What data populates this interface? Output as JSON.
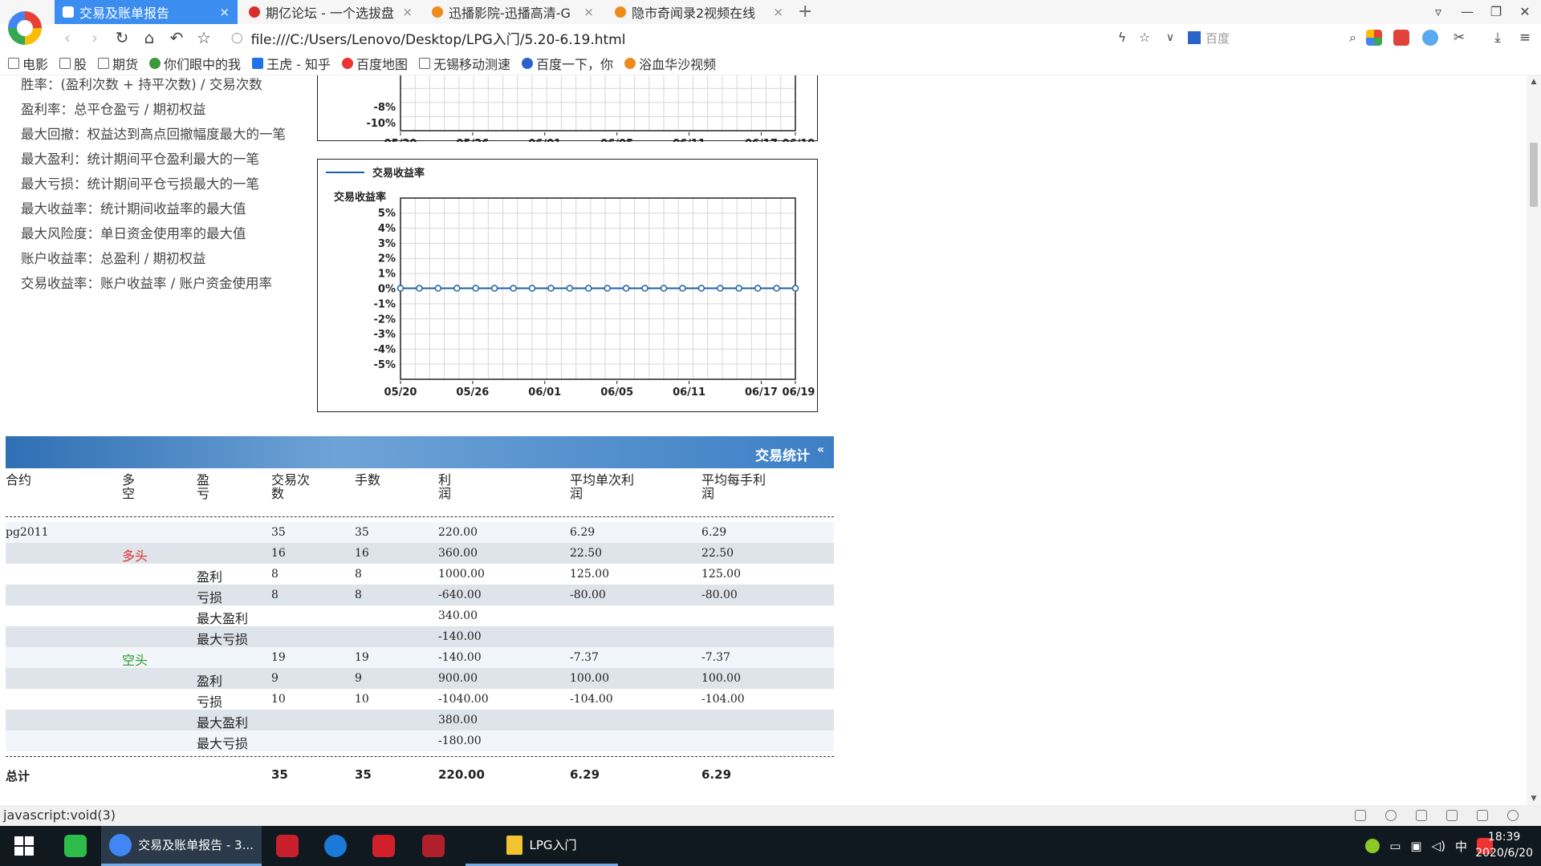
{
  "browser": {
    "tabs": [
      {
        "label": "交易及账单报告",
        "active": true,
        "color": "#ffffff"
      },
      {
        "label": "期亿论坛 - 一个选拔盘",
        "active": false,
        "color": "#d62d2d"
      },
      {
        "label": "迅播影院-迅播高清-G",
        "active": false,
        "color": "#f08a1c"
      },
      {
        "label": "隐市奇闻录2视频在线",
        "active": false,
        "color": "#f08a1c"
      }
    ],
    "url": "file:///C:/Users/Lenovo/Desktop/LPG入门/5.20-6.19.html",
    "search_placeholder": "百度",
    "bookmarks": [
      "电影",
      "股",
      "期货",
      "你们眼中的我",
      "王虎 - 知乎",
      "百度地图",
      "无锡移动测速",
      "百度一下，你",
      "浴血华沙视频"
    ]
  },
  "definitions": [
    "胜率：(盈利次数 + 持平次数) / 交易次数",
    "盈利率：总平仓盈亏 / 期初权益",
    "最大回撤：权益达到高点回撤幅度最大的一笔",
    "最大盈利：统计期间平仓盈利最大的一笔",
    "最大亏损：统计期间平仓亏损最大的一笔",
    "最大收益率：统计期间收益率的最大值",
    "最大风险度：单日资金使用率的最大值",
    "账户收益率：总盈利 / 期初权益",
    "交易收益率：账户收益率 / 账户资金使用率"
  ],
  "chart_data": [
    {
      "type": "line",
      "partial": true,
      "yticks": [
        "-8%",
        "-10%"
      ],
      "xticks": [
        "05/20",
        "05/26",
        "06/01",
        "06/05",
        "06/11",
        "06/17",
        "06/19"
      ],
      "grid": true
    },
    {
      "type": "line",
      "legend": "交易收益率",
      "ylabel": "交易收益率",
      "ylim": [
        -5,
        5
      ],
      "yticks": [
        "5%",
        "4%",
        "3%",
        "2%",
        "1%",
        "0%",
        "-1%",
        "-2%",
        "-3%",
        "-4%",
        "-5%"
      ],
      "xticks": [
        "05/20",
        "05/26",
        "06/01",
        "06/05",
        "06/11",
        "06/17",
        "06/19"
      ],
      "series": [
        {
          "name": "交易收益率",
          "color": "#1f5fa8",
          "values": [
            0,
            0,
            0,
            0,
            0,
            0,
            0,
            0,
            0,
            0,
            0,
            0,
            0,
            0,
            0,
            0,
            0,
            0,
            0,
            0,
            0,
            0
          ]
        }
      ],
      "grid": true
    }
  ],
  "stats": {
    "title": "交易统计",
    "toggle": "«",
    "headers": [
      "合约",
      "多\n空",
      "盈\n亏",
      "交易次\n数",
      "手数",
      "利\n润",
      "平均单次利\n润",
      "平均每手利\n润"
    ],
    "rows": [
      {
        "contract": "pg2011",
        "side": "",
        "pl": "",
        "trades": "35",
        "lots": "35",
        "profit": "220.00",
        "avg_trade": "6.29",
        "avg_lot": "6.29",
        "bg": "light"
      },
      {
        "contract": "",
        "side": "多头",
        "pl": "",
        "trades": "16",
        "lots": "16",
        "profit": "360.00",
        "avg_trade": "22.50",
        "avg_lot": "22.50",
        "bg": "alt"
      },
      {
        "contract": "",
        "side": "",
        "pl": "盈利",
        "trades": "8",
        "lots": "8",
        "profit": "1000.00",
        "avg_trade": "125.00",
        "avg_lot": "125.00",
        "bg": "white"
      },
      {
        "contract": "",
        "side": "",
        "pl": "亏损",
        "trades": "8",
        "lots": "8",
        "profit": "-640.00",
        "avg_trade": "-80.00",
        "avg_lot": "-80.00",
        "bg": "alt"
      },
      {
        "contract": "",
        "side": "",
        "pl": "最大盈利",
        "trades": "",
        "lots": "",
        "profit": "340.00",
        "avg_trade": "",
        "avg_lot": "",
        "bg": "white"
      },
      {
        "contract": "",
        "side": "",
        "pl": "最大亏损",
        "trades": "",
        "lots": "",
        "profit": "-140.00",
        "avg_trade": "",
        "avg_lot": "",
        "bg": "alt"
      },
      {
        "contract": "",
        "side": "空头",
        "pl": "",
        "trades": "19",
        "lots": "19",
        "profit": "-140.00",
        "avg_trade": "-7.37",
        "avg_lot": "-7.37",
        "bg": "light"
      },
      {
        "contract": "",
        "side": "",
        "pl": "盈利",
        "trades": "9",
        "lots": "9",
        "profit": "900.00",
        "avg_trade": "100.00",
        "avg_lot": "100.00",
        "bg": "alt"
      },
      {
        "contract": "",
        "side": "",
        "pl": "亏损",
        "trades": "10",
        "lots": "10",
        "profit": "-1040.00",
        "avg_trade": "-104.00",
        "avg_lot": "-104.00",
        "bg": "white"
      },
      {
        "contract": "",
        "side": "",
        "pl": "最大盈利",
        "trades": "",
        "lots": "",
        "profit": "380.00",
        "avg_trade": "",
        "avg_lot": "",
        "bg": "alt"
      },
      {
        "contract": "",
        "side": "",
        "pl": "最大亏损",
        "trades": "",
        "lots": "",
        "profit": "-180.00",
        "avg_trade": "",
        "avg_lot": "",
        "bg": "light"
      }
    ],
    "total": {
      "label": "总计",
      "trades": "35",
      "lots": "35",
      "profit": "220.00",
      "avg_trade": "6.29",
      "avg_lot": "6.29"
    }
  },
  "status_text": "javascript:void(3)",
  "taskbar": {
    "apps": [
      {
        "label": "",
        "icon": "wechat-icon",
        "color": "#2dbb4a"
      },
      {
        "label": "交易及账单报告 - 3...",
        "icon": "browser-icon",
        "color": "#4285f4",
        "active": true
      },
      {
        "label": "",
        "icon": "app-red-icon",
        "color": "#c8202a"
      },
      {
        "label": "",
        "icon": "kugou-icon",
        "color": "#1b7ad8"
      },
      {
        "label": "",
        "icon": "stock-app-icon",
        "color": "#d0202a"
      },
      {
        "label": "",
        "icon": "wh6-icon",
        "color": "#b0202a"
      },
      {
        "label": "LPG入门",
        "icon": "folder-icon",
        "color": "#f2c230"
      }
    ],
    "ime": "中",
    "time": "18:39",
    "date": "2020/6/20"
  }
}
